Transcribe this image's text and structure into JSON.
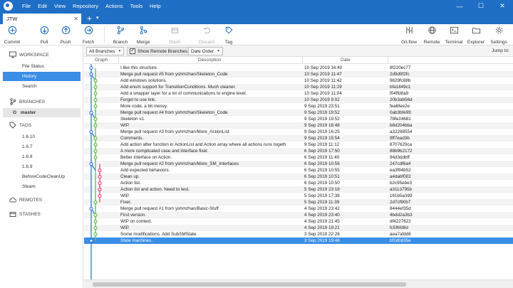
{
  "window": {
    "menu": [
      "File",
      "Edit",
      "View",
      "Repository",
      "Actions",
      "Tools",
      "Help"
    ],
    "controls": {
      "minimize": "—",
      "maximize": "☐",
      "close": "✕"
    }
  },
  "tabs": {
    "repo_tab": "JTW",
    "close": "✕",
    "add": "+",
    "dropdown": "▾"
  },
  "toolbar": {
    "commit": "Commit",
    "pull": "Pull",
    "push": "Push",
    "fetch": "Fetch",
    "branch": "Branch",
    "merge": "Merge",
    "stash": "Stash",
    "discard": "Discard",
    "tag": "Tag",
    "gitflow": "Git-flow",
    "remote": "Remote",
    "terminal": "Terminal",
    "explorer": "Explorer",
    "settings": "Settings"
  },
  "sidebar": {
    "workspace": {
      "label": "WORKSPACE",
      "items": [
        "File Status",
        "History",
        "Search"
      ]
    },
    "branches": {
      "label": "BRANCHES",
      "current_marker": "O",
      "items": [
        "master"
      ]
    },
    "tags": {
      "label": "TAGS",
      "items": [
        "1.6.10",
        "1.6.7",
        "1.6.8",
        "1.6.9",
        "BeforeCodeCleanUp",
        "Steam"
      ]
    },
    "remotes": {
      "label": "REMOTES"
    },
    "stashes": {
      "label": "STASHES"
    }
  },
  "filter": {
    "branches": "All Branches",
    "show_remote": "Show Remote Branches",
    "order": "Date Order",
    "jump_to": "Jump to:"
  },
  "columns": {
    "graph": "Graph",
    "description": "Description",
    "date": "Date",
    "commit": ""
  },
  "colors": {
    "accent": "#1e6fc5",
    "selection": "#3a8ee6",
    "graph_blue": "#3b82d6",
    "graph_green": "#6cc04a",
    "graph_pink": "#e0507a"
  },
  "commits": [
    {
      "desc": "I like this structure.",
      "date": "10 Sep 2019 16:40",
      "hash": "8f220ec77"
    },
    {
      "desc": "Merge pull request #5 from yshmzhan/Skeleton_Code",
      "date": "10 Sep 2019 11:47",
      "hash": "2d9d9f2fc"
    },
    {
      "desc": "Add windows solutions.",
      "date": "10 Sep 2019 11:42",
      "hash": "9829fc88b"
    },
    {
      "desc": "Add enum support for TransitionConditions. Much cleaner.",
      "date": "10 Sep 2019 11:29",
      "hash": "bfa1849c1"
    },
    {
      "desc": "Add a wrapper layer for a lot of communications to engine level.",
      "date": "10 Sep 2019 11:04",
      "hash": "f04ffd8a9"
    },
    {
      "desc": "Forget to use link.",
      "date": "10 Sep 2019 9:02",
      "hash": "20b3ab56d"
    },
    {
      "desc": "More code, a bit messy.",
      "date": "9 Sep 2019 23:51",
      "hash": "fea6fee2e"
    },
    {
      "desc": "Merge pull request #4 from yshmzhan/Skeleton_Code",
      "date": "9 Sep 2019 19:52",
      "hash": "0ab3bfe99"
    },
    {
      "desc": "Skeleton v1.",
      "date": "9 Sep 2019 19:52",
      "hash": "78fe24681"
    },
    {
      "desc": "WIP.",
      "date": "9 Sep 2019 18:48",
      "hash": "b8d204bba"
    },
    {
      "desc": "Merge pull request #3 from yshmzhan/More_ActionList",
      "date": "9 Sep 2019 16:25",
      "hash": "a32288554"
    },
    {
      "desc": "Comments.",
      "date": "9 Sep 2019 15:54",
      "hash": "9ff7ead3b"
    },
    {
      "desc": "Add action after function in ActionList and Action array where all actions runs togeth",
      "date": "9 Sep 2019 11:12",
      "hash": "8707629ca"
    },
    {
      "desc": "A more complicated case and interface fixer.",
      "date": "6 Sep 2019 17:50",
      "hash": "88b9b2172"
    },
    {
      "desc": "Better interface on Action.",
      "date": "6 Sep 2019 11:40",
      "hash": "94d3ddbff"
    },
    {
      "desc": "Merge pull request #2 from yshmzhan/More_SM_Interfaces",
      "date": "6 Sep 2019 10:56",
      "hash": "247cdf6a4"
    },
    {
      "desc": "Add expected behaviors.",
      "date": "6 Sep 2019 10:55",
      "hash": "ea3f94b52"
    },
    {
      "desc": "Clean up.",
      "date": "6 Sep 2019 10:51",
      "hash": "a4dabf002"
    },
    {
      "desc": "Action list.",
      "date": "6 Sep 2019 10:50",
      "hash": "b2c95ebe3"
    },
    {
      "desc": "Action list and action. Need to test.",
      "date": "5 Sep 2019 23:18",
      "hash": "a3113795b"
    },
    {
      "desc": "WIP.",
      "date": "5 Sep 2019 17:38",
      "hash": "161b5a399"
    },
    {
      "desc": "Fixer.",
      "date": "5 Sep 2019 11:39",
      "hash": "2d7cf90b7"
    },
    {
      "desc": "Merge pull request #1 from yshmzhan/Basic-Stuff",
      "date": "4 Sep 2019 23:42",
      "hash": "8444ef35d"
    },
    {
      "desc": "First version.",
      "date": "4 Sep 2019 23:40",
      "hash": "4bdd2a3b3"
    },
    {
      "desc": "WIP on context.",
      "date": "4 Sep 2019 21:45",
      "hash": "df4227622"
    },
    {
      "desc": "WIP.",
      "date": "4 Sep 2019 19:21",
      "hash": "fc5f6fd8d"
    },
    {
      "desc": "Some modifications. Add SubSMState.",
      "date": "3 Sep 2019 22:26",
      "hash": "aea7afdd8"
    },
    {
      "desc": "State machines.",
      "date": "3 Sep 2019 19:48",
      "hash": "bf1d0d35e"
    }
  ]
}
